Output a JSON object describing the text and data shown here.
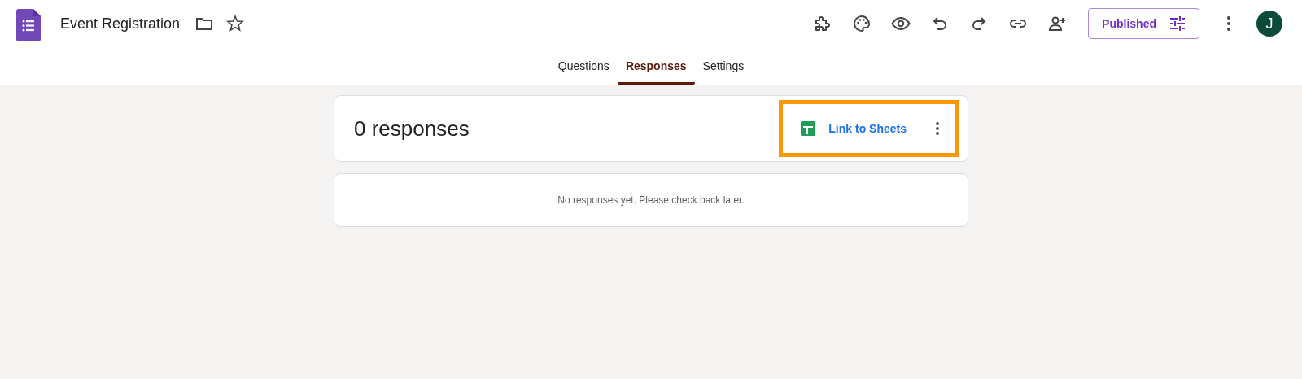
{
  "header": {
    "title": "Event Registration",
    "published_button": "Published",
    "avatar": "J"
  },
  "tabs": [
    {
      "label": "Questions",
      "selected": false
    },
    {
      "label": "Responses",
      "selected": true
    },
    {
      "label": "Settings",
      "selected": false
    }
  ],
  "summary": {
    "count": "0 responses",
    "link_button": "Link to Sheets",
    "highlighted": true
  },
  "empty_message": "No responses yet. Please check back later."
}
